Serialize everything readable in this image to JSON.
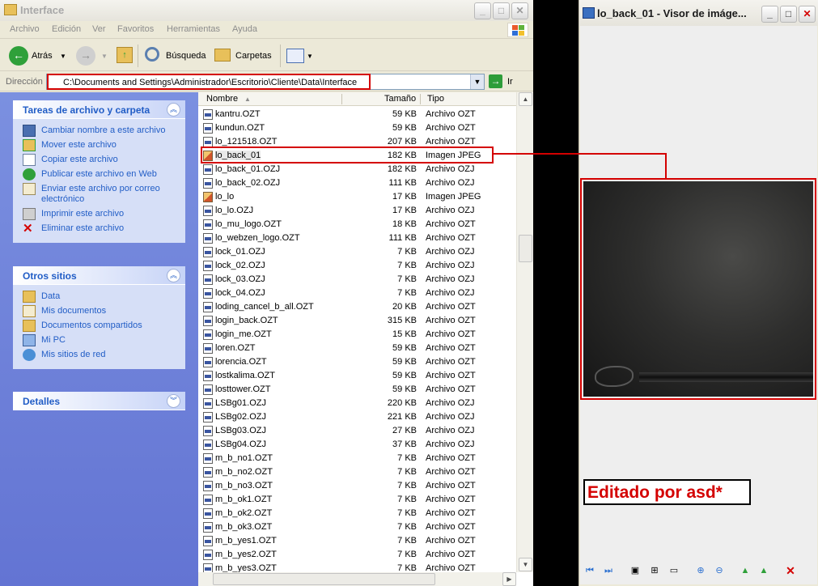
{
  "explorer": {
    "title": "Interface",
    "menu": [
      "Archivo",
      "Edición",
      "Ver",
      "Favoritos",
      "Herramientas",
      "Ayuda"
    ],
    "toolbar": {
      "back_label": "Atrás",
      "search_label": "Búsqueda",
      "folders_label": "Carpetas"
    },
    "address": {
      "label": "Dirección",
      "value": "C:\\Documents and Settings\\Administrador\\Escritorio\\Cliente\\Data\\Interface",
      "go_label": "Ir"
    },
    "tasks": {
      "title": "Tareas de archivo y carpeta",
      "items": [
        "Cambiar nombre a este archivo",
        "Mover este archivo",
        "Copiar este archivo",
        "Publicar este archivo en Web",
        "Enviar este archivo por correo electrónico",
        "Imprimir este archivo",
        "Eliminar este archivo"
      ]
    },
    "other_places": {
      "title": "Otros sitios",
      "items": [
        "Data",
        "Mis documentos",
        "Documentos compartidos",
        "Mi PC",
        "Mis sitios de red"
      ]
    },
    "details": {
      "title": "Detalles"
    },
    "columns": {
      "name": "Nombre",
      "size": "Tamaño",
      "type": "Tipo"
    },
    "files": [
      {
        "name": "kantru.OZT",
        "size": "59 KB",
        "type": "Archivo OZT"
      },
      {
        "name": "kundun.OZT",
        "size": "59 KB",
        "type": "Archivo OZT"
      },
      {
        "name": "lo_121518.OZT",
        "size": "207 KB",
        "type": "Archivo OZT"
      },
      {
        "name": "lo_back_01",
        "size": "182 KB",
        "type": "Imagen JPEG",
        "kind": "jpg",
        "selected": true
      },
      {
        "name": "lo_back_01.OZJ",
        "size": "182 KB",
        "type": "Archivo OZJ"
      },
      {
        "name": "lo_back_02.OZJ",
        "size": "111 KB",
        "type": "Archivo OZJ"
      },
      {
        "name": "lo_lo",
        "size": "17 KB",
        "type": "Imagen JPEG",
        "kind": "jpg"
      },
      {
        "name": "lo_lo.OZJ",
        "size": "17 KB",
        "type": "Archivo OZJ"
      },
      {
        "name": "lo_mu_logo.OZT",
        "size": "18 KB",
        "type": "Archivo OZT"
      },
      {
        "name": "lo_webzen_logo.OZT",
        "size": "111 KB",
        "type": "Archivo OZT"
      },
      {
        "name": "lock_01.OZJ",
        "size": "7 KB",
        "type": "Archivo OZJ"
      },
      {
        "name": "lock_02.OZJ",
        "size": "7 KB",
        "type": "Archivo OZJ"
      },
      {
        "name": "lock_03.OZJ",
        "size": "7 KB",
        "type": "Archivo OZJ"
      },
      {
        "name": "lock_04.OZJ",
        "size": "7 KB",
        "type": "Archivo OZJ"
      },
      {
        "name": "loding_cancel_b_all.OZT",
        "size": "20 KB",
        "type": "Archivo OZT"
      },
      {
        "name": "login_back.OZT",
        "size": "315 KB",
        "type": "Archivo OZT"
      },
      {
        "name": "login_me.OZT",
        "size": "15 KB",
        "type": "Archivo OZT"
      },
      {
        "name": "loren.OZT",
        "size": "59 KB",
        "type": "Archivo OZT"
      },
      {
        "name": "lorencia.OZT",
        "size": "59 KB",
        "type": "Archivo OZT"
      },
      {
        "name": "lostkalima.OZT",
        "size": "59 KB",
        "type": "Archivo OZT"
      },
      {
        "name": "losttower.OZT",
        "size": "59 KB",
        "type": "Archivo OZT"
      },
      {
        "name": "LSBg01.OZJ",
        "size": "220 KB",
        "type": "Archivo OZJ"
      },
      {
        "name": "LSBg02.OZJ",
        "size": "221 KB",
        "type": "Archivo OZJ"
      },
      {
        "name": "LSBg03.OZJ",
        "size": "27 KB",
        "type": "Archivo OZJ"
      },
      {
        "name": "LSBg04.OZJ",
        "size": "37 KB",
        "type": "Archivo OZJ"
      },
      {
        "name": "m_b_no1.OZT",
        "size": "7 KB",
        "type": "Archivo OZT"
      },
      {
        "name": "m_b_no2.OZT",
        "size": "7 KB",
        "type": "Archivo OZT"
      },
      {
        "name": "m_b_no3.OZT",
        "size": "7 KB",
        "type": "Archivo OZT"
      },
      {
        "name": "m_b_ok1.OZT",
        "size": "7 KB",
        "type": "Archivo OZT"
      },
      {
        "name": "m_b_ok2.OZT",
        "size": "7 KB",
        "type": "Archivo OZT"
      },
      {
        "name": "m_b_ok3.OZT",
        "size": "7 KB",
        "type": "Archivo OZT"
      },
      {
        "name": "m_b_yes1.OZT",
        "size": "7 KB",
        "type": "Archivo OZT"
      },
      {
        "name": "m_b_yes2.OZT",
        "size": "7 KB",
        "type": "Archivo OZT"
      },
      {
        "name": "m_b_yes3.OZT",
        "size": "7 KB",
        "type": "Archivo OZT"
      }
    ]
  },
  "viewer": {
    "title": "lo_back_01 - Visor de imáge...",
    "edit_label": "Editado por asd*"
  },
  "colors": {
    "highlight": "#d40000",
    "link": "#215dc6",
    "taskpane": "#6b7fd9"
  }
}
